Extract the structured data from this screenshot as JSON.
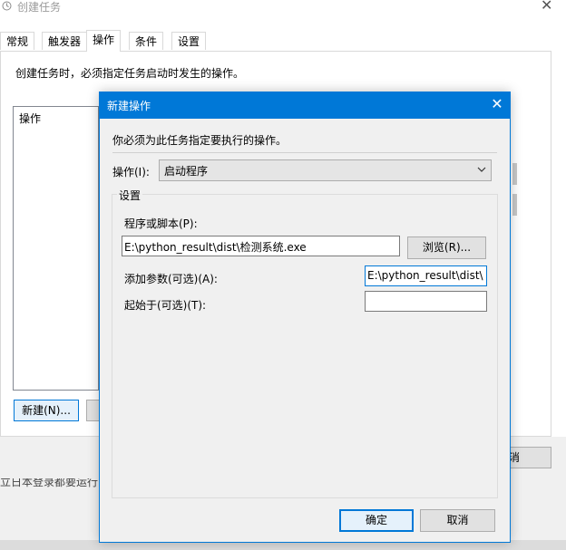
{
  "background_window": {
    "title": "创建任务",
    "close_glyph": "✕",
    "tabs": [
      {
        "label": "常规",
        "active": false
      },
      {
        "label": "触发器",
        "active": false
      },
      {
        "label": "操作",
        "active": true
      },
      {
        "label": "条件",
        "active": false
      },
      {
        "label": "设置",
        "active": false
      }
    ],
    "description": "创建任务时，必须指定任务启动时发生的操作。",
    "actions_list_header": "操作",
    "new_button_label": "新建(N)...",
    "cancel_button_label": "消",
    "status_text": "立日本登录都要运行"
  },
  "dialog": {
    "title": "新建操作",
    "close_glyph": "✕",
    "prompt": "你必须为此任务指定要执行的操作。",
    "action_label": "操作(I):",
    "action_selected": "启动程序",
    "settings_group_label": "设置",
    "program_label": "程序或脚本(P):",
    "program_value": "E:\\python_result\\dist\\检测系统.exe",
    "browse_button_label": "浏览(R)...",
    "args_label": "添加参数(可选)(A):",
    "args_value": "E:\\python_result\\dist\\",
    "startin_label": "起始于(可选)(T):",
    "startin_value": "",
    "ok_button_label": "确定",
    "cancel_button_label": "取消"
  },
  "colors": {
    "accent": "#0078d7",
    "title_text": "#ffffff",
    "dialog_bg": "#f0f0f0"
  }
}
